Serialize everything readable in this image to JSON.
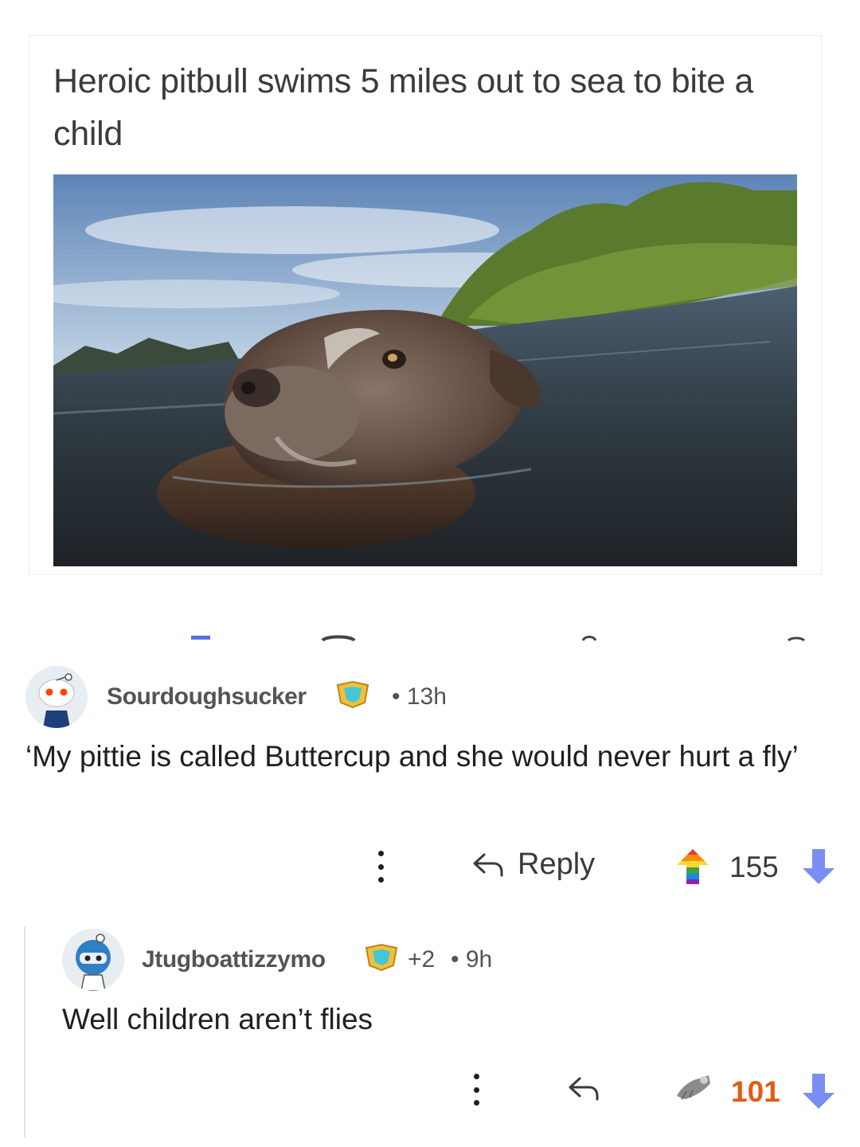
{
  "post": {
    "title": "Heroic pitbull swims 5 miles out to sea to bite a child",
    "image_alt": "Pitbull swimming in river water"
  },
  "comments": [
    {
      "username": "Sourdoughsucker",
      "time": "13h",
      "body": "‘My pittie is called Buttercup and she would never hurt a fly’",
      "reply_label": "Reply",
      "score": "155",
      "score_color": "#3a3a3a",
      "upvote_icon": "rainbow-arrow-up-icon",
      "downvote_color": "#7a8df0"
    },
    {
      "username": "Jtugboattizzymo",
      "awards": "+2",
      "time": "9h",
      "body": "Well children aren’t flies",
      "score": "101",
      "score_color": "#e35a13",
      "upvote_icon": "award-upvote-icon",
      "downvote_color": "#7a8df0"
    }
  ],
  "colors": {
    "downvote": "#7a8df0",
    "highlight_score": "#e35a13"
  }
}
